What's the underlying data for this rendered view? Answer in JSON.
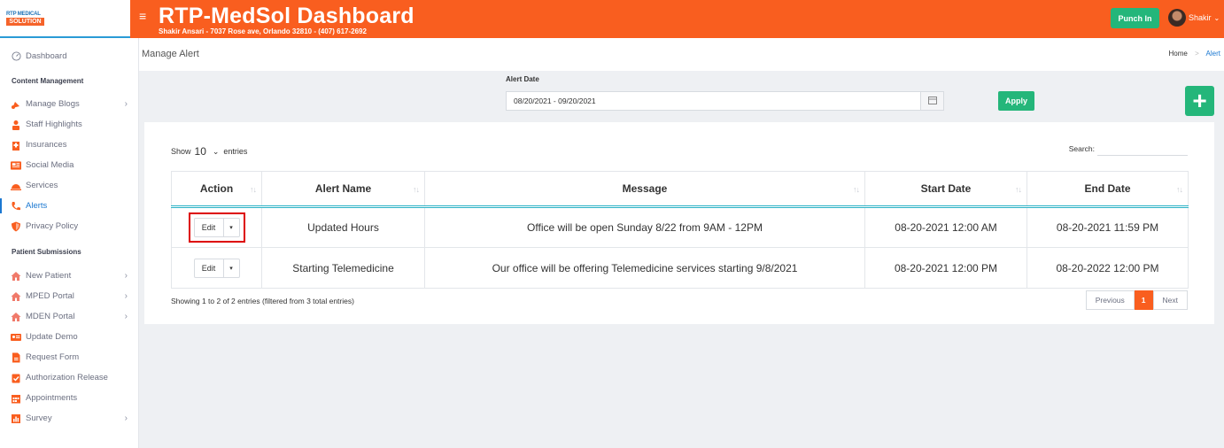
{
  "sidebar": {
    "logo": {
      "line1": "RTP MEDICAL",
      "line2": "SOLUTION"
    },
    "dashboard": "Dashboard",
    "content_heading": "Content Management",
    "content_items": [
      {
        "label": "Manage Blogs",
        "icon": "blog-icon",
        "chevron": "›"
      },
      {
        "label": "Staff Highlights",
        "icon": "staff-icon"
      },
      {
        "label": "Insurances",
        "icon": "hospital-icon"
      },
      {
        "label": "Social Media",
        "icon": "social-media-icon"
      },
      {
        "label": "Services",
        "icon": "services-icon"
      },
      {
        "label": "Alerts",
        "icon": "phone-icon",
        "active": true
      },
      {
        "label": "Privacy Policy",
        "icon": "shield-icon"
      }
    ],
    "patient_heading": "Patient Submissions",
    "patient_items": [
      {
        "label": "New Patient",
        "icon": "home-icon",
        "chevron": "›"
      },
      {
        "label": "MPED Portal",
        "icon": "home-icon",
        "chevron": "›"
      },
      {
        "label": "MDEN Portal",
        "icon": "home-icon",
        "chevron": "›"
      },
      {
        "label": "Update Demo",
        "icon": "id-card-icon"
      },
      {
        "label": "Request Form",
        "icon": "file-icon"
      },
      {
        "label": "Authorization Release",
        "icon": "check-clipboard-icon"
      },
      {
        "label": "Appointments",
        "icon": "calendar-icon"
      },
      {
        "label": "Survey",
        "icon": "chart-icon",
        "chevron": "›"
      }
    ]
  },
  "header": {
    "hamburger": "≡",
    "title": "RTP-MedSol Dashboard",
    "subtitle": "Shakir Ansari - 7037 Rose ave, Orlando 32810 - (407) 617-2692",
    "punch_in": "Punch In",
    "user_name": "Shakir",
    "user_caret": "⌄"
  },
  "page": {
    "title": "Manage Alert",
    "breadcrumb": {
      "home": "Home",
      "sep": ">",
      "current": "Alert"
    }
  },
  "filter": {
    "label": "Alert Date",
    "date_range": "08/20/2021 - 09/20/2021",
    "apply": "Apply",
    "add": "+"
  },
  "table": {
    "show_label": "Show",
    "page_size": "10",
    "page_size_caret": "⌄",
    "entries_label": "entries",
    "search_label": "Search:",
    "sort_glyph": "↑↓",
    "columns": [
      "Action",
      "Alert Name",
      "Message",
      "Start Date",
      "End Date"
    ],
    "edit_label": "Edit",
    "dropdown_caret": "▾",
    "rows": [
      {
        "name": "Updated Hours",
        "message": "Office will be open Sunday 8/22 from 9AM - 12PM",
        "start": "08-20-2021 12:00 AM",
        "end": "08-20-2021 11:59 PM"
      },
      {
        "name": "Starting Telemedicine",
        "message": "Our office will be offering Telemedicine services starting 9/8/2021",
        "start": "08-20-2021 12:00 PM",
        "end": "08-20-2022 12:00 PM"
      }
    ],
    "info": "Showing 1 to 2 of 2 entries (filtered from 3 total entries)",
    "pagination": {
      "previous": "Previous",
      "current": "1",
      "next": "Next"
    }
  },
  "colors": {
    "brand_orange": "#f95e1f",
    "accent_green": "#24b67a",
    "link_blue": "#1b78d1",
    "highlight_red": "#dd0000"
  }
}
